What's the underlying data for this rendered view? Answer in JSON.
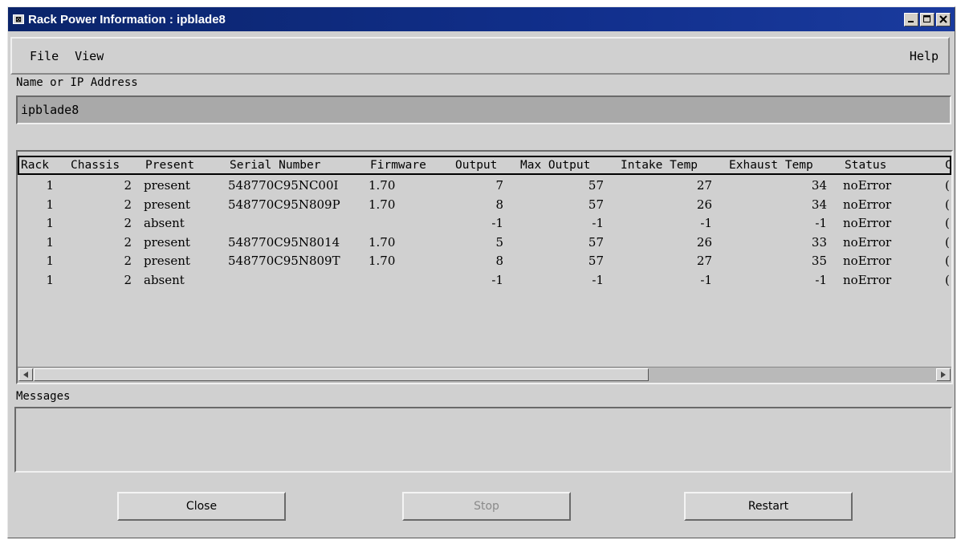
{
  "window": {
    "title": "Rack Power Information : ipblade8"
  },
  "menu": {
    "file": "File",
    "view": "View",
    "help": "Help"
  },
  "address": {
    "label": "Name or IP Address",
    "value": "ipblade8"
  },
  "table": {
    "headers": [
      "Rack",
      "Chassis",
      "Present",
      "Serial Number",
      "Firmware",
      "Output",
      "Max Output",
      "Intake Temp",
      "Exhaust Temp",
      "Status"
    ],
    "rows": [
      [
        "1",
        "2",
        "present",
        "548770C95NC00I",
        "1.70",
        "7",
        "57",
        "27",
        "34",
        "noError"
      ],
      [
        "1",
        "2",
        "present",
        "548770C95N809P",
        "1.70",
        "8",
        "57",
        "26",
        "34",
        "noError"
      ],
      [
        "1",
        "2",
        "absent",
        "",
        "",
        "-1",
        "-1",
        "-1",
        "-1",
        "noError"
      ],
      [
        "1",
        "2",
        "present",
        "548770C95N8014",
        "1.70",
        "5",
        "57",
        "26",
        "33",
        "noError"
      ],
      [
        "1",
        "2",
        "present",
        "548770C95N809T",
        "1.70",
        "8",
        "57",
        "27",
        "35",
        "noError"
      ],
      [
        "1",
        "2",
        "absent",
        "",
        "",
        "-1",
        "-1",
        "-1",
        "-1",
        "noError"
      ]
    ],
    "clipped_column_header": "C",
    "clipped_column_cell": "("
  },
  "messages": {
    "label": "Messages",
    "text": ""
  },
  "buttons": {
    "close": "Close",
    "stop": "Stop",
    "restart": "Restart"
  }
}
